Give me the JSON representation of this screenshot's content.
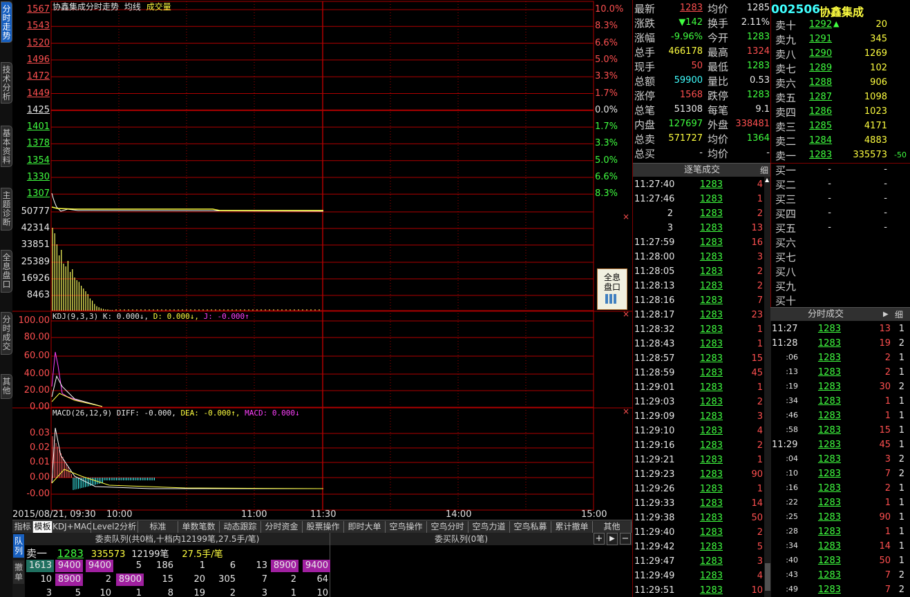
{
  "left_tabs": [
    "分时走势",
    "技术分析",
    "基本资料",
    "主题诊断",
    "全息盘口",
    "分时成交",
    "其他"
  ],
  "chart": {
    "title": "协鑫集成分时走势",
    "avg_label": "均线",
    "vol_label": "成交量",
    "price_ticks": [
      "1567",
      "1543",
      "1520",
      "1496",
      "1472",
      "1449",
      "1425",
      "1401",
      "1378",
      "1354",
      "1330",
      "1307"
    ],
    "pct_ticks_up": [
      "10.0%",
      "8.3%",
      "6.6%",
      "5.0%",
      "3.3%",
      "1.7%",
      "0.0%"
    ],
    "pct_ticks_down": [
      "1.7%",
      "3.3%",
      "5.0%",
      "6.6%",
      "8.3%"
    ],
    "vol_ticks": [
      "50777",
      "42314",
      "33851",
      "25389",
      "16926",
      "8463"
    ],
    "kdj_title": "KDJ(9,3,3)",
    "kdj_k": "K: 0.000↓,",
    "kdj_d": "D: 0.000↓,",
    "kdj_j": "J: -0.000↑",
    "kdj_ticks": [
      "100.00",
      "80.00",
      "60.00",
      "40.00",
      "20.00",
      "0.00"
    ],
    "macd_title": "MACD(26,12,9)",
    "macd_diff": "DIFF: -0.000,",
    "macd_dea": "DEA: -0.000↑,",
    "macd_val": "MACD: 0.000↓",
    "macd_ticks": [
      "0.03",
      "0.02",
      "0.01",
      "0.00",
      "-0.00"
    ],
    "time_labels": [
      "2015/08/21, 09:30",
      "10:00",
      "11:00",
      "11:30",
      "14:00",
      "15:00"
    ],
    "full_btn": "全息盘口"
  },
  "bottom_tabs": [
    "指标",
    "模板",
    "KDJ+MACD",
    "Level2分析",
    "标准",
    "单数笔数",
    "动态跟踪",
    "分时资金",
    "股票操作",
    "即时大单",
    "空鸟操作",
    "空鸟分时",
    "空鸟力道",
    "空鸟私募",
    "累计撤单",
    "其他"
  ],
  "queue": {
    "sell_title": "委卖队列(共0档,十档内12199笔,27.5手/笔)",
    "buy_title": "委买队列(0笔)",
    "side_tabs": [
      "队列",
      "撤单"
    ],
    "line1": {
      "label": "卖一",
      "price": "1283",
      "vol": "335573",
      "count": "12199笔",
      "avg": "27.5手/笔"
    },
    "row1": [
      "1613",
      "9400",
      "9400",
      "5",
      "186",
      "1",
      "6",
      "13",
      "8900",
      "9400"
    ],
    "row2": [
      "10",
      "8900",
      "2",
      "8900",
      "15",
      "20",
      "305",
      "7",
      "2",
      "64"
    ],
    "row3": [
      "3",
      "5",
      "10",
      "1",
      "8",
      "19",
      "2",
      "3",
      "1",
      "10"
    ]
  },
  "quote": {
    "code": "002506",
    "name": "协鑫集成",
    "rows": [
      {
        "k1": "最新",
        "v1": "1283",
        "k2": "均价",
        "v2": "1285"
      },
      {
        "k1": "涨跌",
        "v1": "▼142",
        "k2": "换手",
        "v2": "2.11%"
      },
      {
        "k1": "涨幅",
        "v1": "-9.96%",
        "k2": "今开",
        "v2": "1283"
      },
      {
        "k1": "总手",
        "v1": "466178",
        "k2": "最高",
        "v2": "1324"
      },
      {
        "k1": "现手",
        "v1": "50",
        "k2": "最低",
        "v2": "1283"
      },
      {
        "k1": "总额",
        "v1": "59900",
        "k2": "量比",
        "v2": "0.53"
      },
      {
        "k1": "涨停",
        "v1": "1568",
        "k2": "跌停",
        "v2": "1283"
      },
      {
        "k1": "总笔",
        "v1": "51308",
        "k2": "每笔",
        "v2": "9.1"
      },
      {
        "k1": "内盘",
        "v1": "127697",
        "k2": "外盘",
        "v2": "338481"
      },
      {
        "k1": "总卖",
        "v1": "571727",
        "k2": "均价",
        "v2": "1364"
      },
      {
        "k1": "总买",
        "v1": "-",
        "k2": "均价",
        "v2": "-"
      }
    ]
  },
  "book": {
    "sells": [
      {
        "label": "卖十",
        "price": "1292",
        "vol": "20",
        "arrow": "▲"
      },
      {
        "label": "卖九",
        "price": "1291",
        "vol": "345"
      },
      {
        "label": "卖八",
        "price": "1290",
        "vol": "1269"
      },
      {
        "label": "卖七",
        "price": "1289",
        "vol": "102"
      },
      {
        "label": "卖六",
        "price": "1288",
        "vol": "906"
      },
      {
        "label": "卖五",
        "price": "1287",
        "vol": "1098"
      },
      {
        "label": "卖四",
        "price": "1286",
        "vol": "1023"
      },
      {
        "label": "卖三",
        "price": "1285",
        "vol": "4171"
      },
      {
        "label": "卖二",
        "price": "1284",
        "vol": "4883"
      },
      {
        "label": "卖一",
        "price": "1283",
        "vol": "335573",
        "chg": "-50"
      }
    ],
    "buys": [
      {
        "label": "买一",
        "price": "-",
        "vol": "-"
      },
      {
        "label": "买二",
        "price": "-",
        "vol": "-"
      },
      {
        "label": "买三",
        "price": "-",
        "vol": "-"
      },
      {
        "label": "买四",
        "price": "-",
        "vol": "-"
      },
      {
        "label": "买五",
        "price": "-",
        "vol": "-"
      },
      {
        "label": "买六",
        "price": "",
        "vol": ""
      },
      {
        "label": "买七",
        "price": "",
        "vol": ""
      },
      {
        "label": "买八",
        "price": "",
        "vol": ""
      },
      {
        "label": "买九",
        "price": "",
        "vol": ""
      },
      {
        "label": "买十",
        "price": "",
        "vol": ""
      }
    ]
  },
  "deals": {
    "title": "逐笔成交",
    "detail": "细",
    "rows": [
      {
        "t": "11:27:40",
        "p": "1283",
        "v": "4"
      },
      {
        "t": "11:27:46",
        "p": "1283",
        "v": "1"
      },
      {
        "t": "2",
        "p": "1283",
        "v": "2"
      },
      {
        "t": "3",
        "p": "1283",
        "v": "13"
      },
      {
        "t": "11:27:59",
        "p": "1283",
        "v": "16"
      },
      {
        "t": "11:28:00",
        "p": "1283",
        "v": "3"
      },
      {
        "t": "11:28:05",
        "p": "1283",
        "v": "2"
      },
      {
        "t": "11:28:13",
        "p": "1283",
        "v": "2"
      },
      {
        "t": "11:28:16",
        "p": "1283",
        "v": "7"
      },
      {
        "t": "11:28:17",
        "p": "1283",
        "v": "23"
      },
      {
        "t": "11:28:32",
        "p": "1283",
        "v": "1"
      },
      {
        "t": "11:28:43",
        "p": "1283",
        "v": "1"
      },
      {
        "t": "11:28:57",
        "p": "1283",
        "v": "15"
      },
      {
        "t": "11:28:59",
        "p": "1283",
        "v": "45"
      },
      {
        "t": "11:29:01",
        "p": "1283",
        "v": "1"
      },
      {
        "t": "11:29:03",
        "p": "1283",
        "v": "2"
      },
      {
        "t": "11:29:09",
        "p": "1283",
        "v": "3"
      },
      {
        "t": "11:29:10",
        "p": "1283",
        "v": "4"
      },
      {
        "t": "11:29:16",
        "p": "1283",
        "v": "2"
      },
      {
        "t": "11:29:21",
        "p": "1283",
        "v": "1"
      },
      {
        "t": "11:29:23",
        "p": "1283",
        "v": "90"
      },
      {
        "t": "11:29:26",
        "p": "1283",
        "v": "1"
      },
      {
        "t": "11:29:33",
        "p": "1283",
        "v": "14"
      },
      {
        "t": "11:29:38",
        "p": "1283",
        "v": "50"
      },
      {
        "t": "11:29:40",
        "p": "1283",
        "v": "2"
      },
      {
        "t": "11:29:42",
        "p": "1283",
        "v": "5"
      },
      {
        "t": "11:29:47",
        "p": "1283",
        "v": "3"
      },
      {
        "t": "11:29:49",
        "p": "1283",
        "v": "4"
      },
      {
        "t": "11:29:51",
        "p": "1283",
        "v": "10"
      }
    ]
  },
  "minute": {
    "title": "分时成交",
    "detail": "细",
    "rows": [
      {
        "t": "11:27",
        "p": "1283",
        "v": "13",
        "n": "1"
      },
      {
        "t": "11:28",
        "p": "1283",
        "v": "19",
        "n": "2"
      },
      {
        "t": ":06",
        "p": "1283",
        "v": "2",
        "n": "1"
      },
      {
        "t": ":13",
        "p": "1283",
        "v": "2",
        "n": "1"
      },
      {
        "t": ":19",
        "p": "1283",
        "v": "30",
        "n": "2"
      },
      {
        "t": ":34",
        "p": "1283",
        "v": "1",
        "n": "1"
      },
      {
        "t": ":46",
        "p": "1283",
        "v": "1",
        "n": "1"
      },
      {
        "t": ":58",
        "p": "1283",
        "v": "15",
        "n": "1"
      },
      {
        "t": "11:29",
        "p": "1283",
        "v": "45",
        "n": "1"
      },
      {
        "t": ":04",
        "p": "1283",
        "v": "3",
        "n": "2"
      },
      {
        "t": ":10",
        "p": "1283",
        "v": "7",
        "n": "2"
      },
      {
        "t": ":16",
        "p": "1283",
        "v": "2",
        "n": "1"
      },
      {
        "t": ":22",
        "p": "1283",
        "v": "1",
        "n": "1"
      },
      {
        "t": ":25",
        "p": "1283",
        "v": "90",
        "n": "1"
      },
      {
        "t": ":28",
        "p": "1283",
        "v": "1",
        "n": "1"
      },
      {
        "t": ":34",
        "p": "1283",
        "v": "14",
        "n": "1"
      },
      {
        "t": ":40",
        "p": "1283",
        "v": "50",
        "n": "1"
      },
      {
        "t": ":43",
        "p": "1283",
        "v": "7",
        "n": "2"
      },
      {
        "t": ":49",
        "p": "1283",
        "v": "7",
        "n": "2"
      }
    ]
  }
}
